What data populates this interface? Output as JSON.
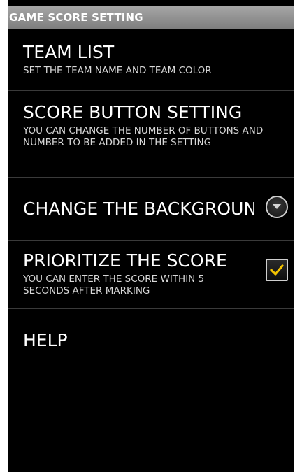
{
  "header": {
    "title": "GAME SCORE SETTING"
  },
  "settings": {
    "team_list": {
      "title": "TEAM LIST",
      "subtitle": "SET THE TEAM NAME AND TEAM COLOR"
    },
    "score_button": {
      "title": "SCORE BUTTON SETTING",
      "subtitle": "YOU CAN CHANGE THE NUMBER OF BUTTONS AND NUMBER TO BE ADDED IN THE SETTING"
    },
    "background": {
      "title": "CHANGE THE BACKGROUND",
      "icon": "dropdown-circle-icon"
    },
    "prioritize": {
      "title": "PRIORITIZE THE SCORE",
      "subtitle": "YOU CAN ENTER THE SCORE WITHIN 5 SECONDS AFTER MARKING",
      "checked": true,
      "check_color": "#f5c400"
    },
    "help": {
      "title": "HELP"
    }
  },
  "colors": {
    "background": "#000000",
    "header_bg": "#8c8c8c",
    "accent": "#f5c400"
  }
}
